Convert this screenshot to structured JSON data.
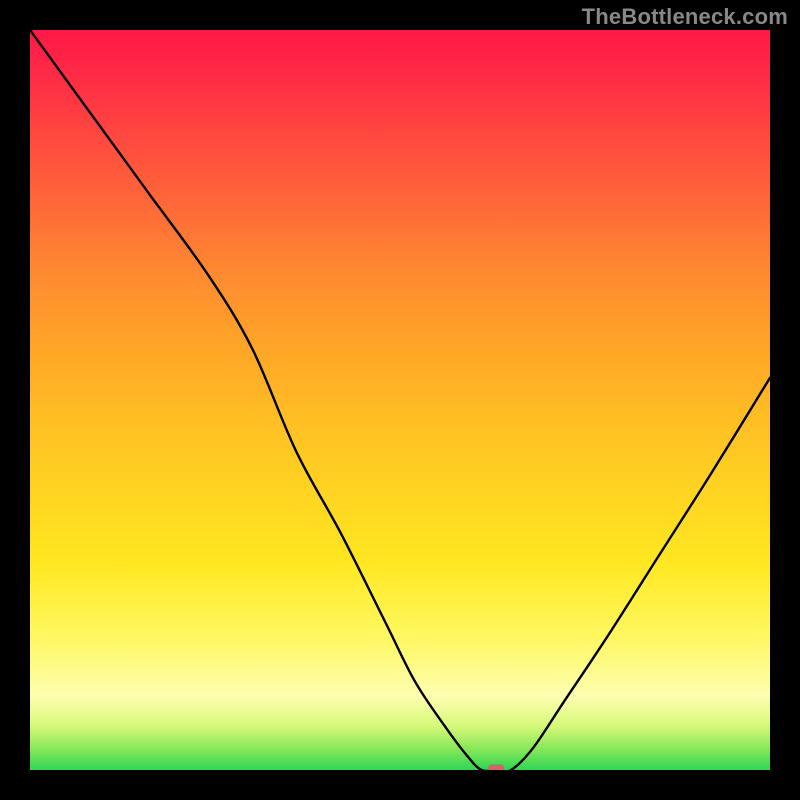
{
  "watermark": "TheBottleneck.com",
  "chart_data": {
    "type": "line",
    "title": "",
    "xlabel": "",
    "ylabel": "",
    "xlim": [
      0,
      100
    ],
    "ylim": [
      0,
      100
    ],
    "grid": false,
    "legend": false,
    "background_gradient": {
      "top_color": "#ff1846",
      "mid_color": "#ffd322",
      "bottom_color": "#2ed657"
    },
    "series": [
      {
        "name": "bottleneck-curve",
        "color": "#000000",
        "x": [
          0,
          8,
          16,
          24,
          30,
          36,
          42,
          48,
          52,
          56,
          59,
          61,
          63,
          65,
          68,
          72,
          78,
          85,
          92,
          100
        ],
        "y": [
          100,
          89,
          78,
          67,
          57,
          43,
          32,
          20,
          12,
          6,
          2,
          0,
          0,
          0,
          3,
          9,
          18,
          29,
          40,
          53
        ]
      }
    ],
    "marker": {
      "name": "optimal-point",
      "shape": "rounded-rect",
      "color": "#c96a6a",
      "x": 63,
      "y": 0,
      "width_pct": 2.2,
      "height_pct": 1.0
    }
  }
}
